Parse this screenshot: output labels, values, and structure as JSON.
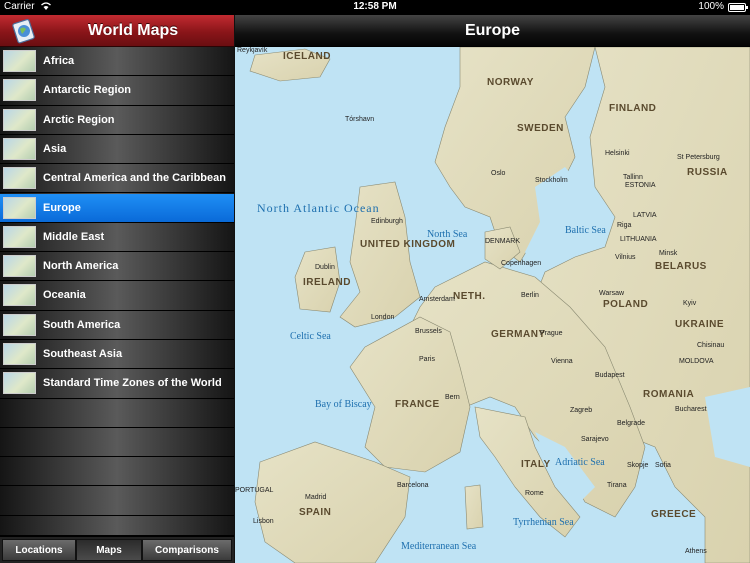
{
  "status_bar": {
    "carrier": "Carrier",
    "time": "12:58 PM",
    "battery": "100%",
    "battery_level": 1.0
  },
  "sidebar": {
    "title": "World Maps",
    "items": [
      {
        "label": "Africa",
        "selected": false
      },
      {
        "label": "Antarctic Region",
        "selected": false
      },
      {
        "label": "Arctic Region",
        "selected": false
      },
      {
        "label": "Asia",
        "selected": false
      },
      {
        "label": "Central America and the Caribbean",
        "selected": false
      },
      {
        "label": "Europe",
        "selected": true
      },
      {
        "label": "Middle East",
        "selected": false
      },
      {
        "label": "North America",
        "selected": false
      },
      {
        "label": "Oceania",
        "selected": false
      },
      {
        "label": "South America",
        "selected": false
      },
      {
        "label": "Southeast Asia",
        "selected": false
      },
      {
        "label": "Standard Time Zones of the World",
        "selected": false
      }
    ],
    "tabs": [
      {
        "label": "Locations",
        "active": false
      },
      {
        "label": "Maps",
        "active": true
      },
      {
        "label": "Comparisons",
        "active": false
      }
    ]
  },
  "main": {
    "title": "Europe",
    "map_labels": {
      "iceland": "ICELAND",
      "reykjavik": "Reykjavík",
      "norway": "NORWAY",
      "sweden": "SWEDEN",
      "finland": "FINLAND",
      "russia": "RUSSIA",
      "estonia": "ESTONIA",
      "latvia": "LATVIA",
      "lithuania": "LITHUANIA",
      "belarus": "BELARUS",
      "ukraine": "UKRAINE",
      "poland": "POLAND",
      "germany": "GERMANY",
      "denmark": "DENMARK",
      "united_kingdom": "UNITED KINGDOM",
      "ireland": "IRELAND",
      "netherlands": "NETH.",
      "france": "FRANCE",
      "spain": "SPAIN",
      "portugal": "PORTUGAL",
      "italy": "ITALY",
      "romania": "ROMANIA",
      "greece": "GREECE",
      "moldova": "MOLDOVA",
      "north_atlantic": "North Atlantic Ocean",
      "north_sea": "North Sea",
      "baltic_sea": "Baltic Sea",
      "bay_of_biscay": "Bay of Biscay",
      "mediterranean": "Mediterranean Sea",
      "adriatic": "Adriatic Sea",
      "tyrrhenian": "Tyrrhenian Sea",
      "celtic_sea": "Celtic Sea",
      "oslo": "Oslo",
      "stockholm": "Stockholm",
      "helsinki": "Helsinki",
      "tallinn": "Tallinn",
      "riga": "Riga",
      "vilnius": "Vilnius",
      "minsk": "Minsk",
      "moscow": "St Petersburg",
      "warsaw": "Warsaw",
      "berlin": "Berlin",
      "copenhagen": "Copenhagen",
      "london": "London",
      "dublin": "Dublin",
      "paris": "Paris",
      "madrid": "Madrid",
      "lisbon": "Lisbon",
      "rome": "Rome",
      "vienna": "Vienna",
      "budapest": "Budapest",
      "prague": "Prague",
      "amsterdam": "Amsterdam",
      "brussels": "Brussels",
      "bern": "Bern",
      "bucharest": "Bucharest",
      "kyiv": "Kyiv",
      "chisinau": "Chisinau",
      "athens": "Athens",
      "barcelona": "Barcelona",
      "edinburgh": "Edinburgh",
      "torshavn": "Tórshavn",
      "belgrade": "Belgrade",
      "sofia": "Sofia",
      "zagreb": "Zagreb",
      "tirana": "Tirana",
      "skopje": "Skopje",
      "sarajevo": "Sarajevo"
    }
  }
}
